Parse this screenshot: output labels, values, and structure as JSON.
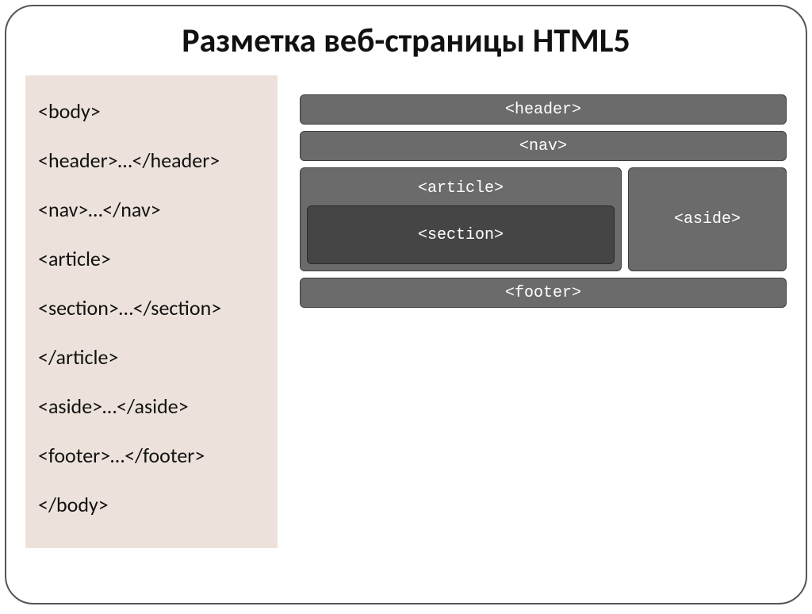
{
  "title": "Разметка веб-страницы HTML5",
  "code": {
    "l0": "<body>",
    "l1": "<header>…</header>",
    "l2": "<nav>…</nav>",
    "l3": "<article>",
    "l4": "<section>…</section>",
    "l5": "</article>",
    "l6": "<aside>…</aside>",
    "l7": "<footer>…</footer>",
    "l8": "</body>"
  },
  "diagram": {
    "header": "<header>",
    "nav": "<nav>",
    "article": "<article>",
    "section": "<section>",
    "aside": "<aside>",
    "footer": "<footer>"
  }
}
